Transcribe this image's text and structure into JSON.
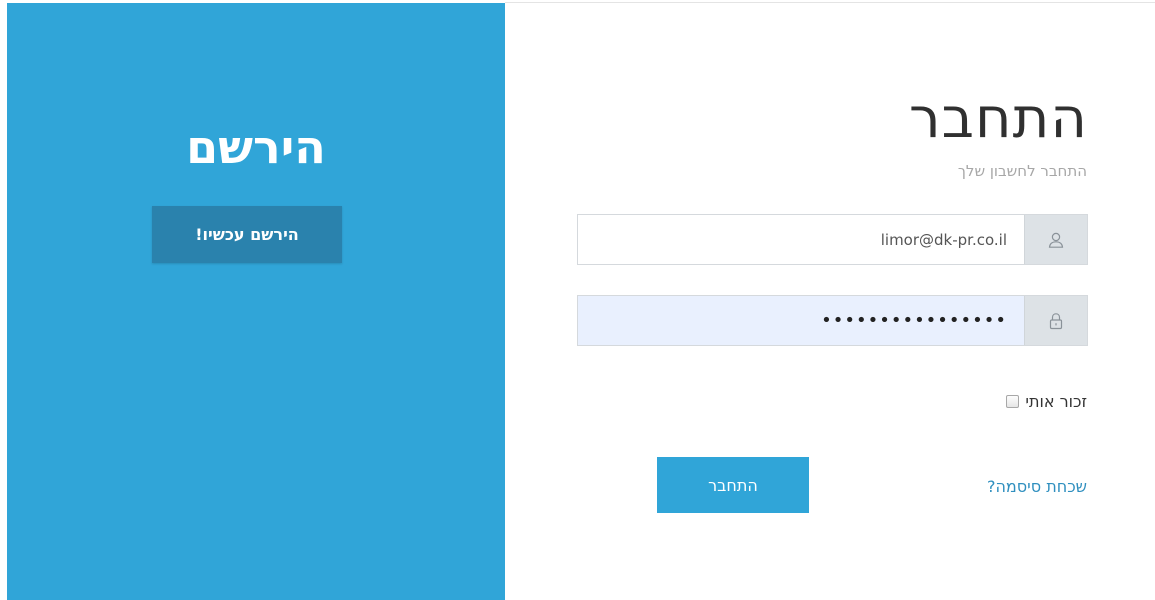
{
  "register": {
    "title": "הירשם",
    "button_label": "הירשם עכשיו!"
  },
  "login": {
    "title": "התחבר",
    "subtitle": "התחבר לחשבון שלך",
    "email": {
      "value": "limor@dk-pr.co.il",
      "icon": "user-icon"
    },
    "password": {
      "value": "••••••••••••••••",
      "icon": "lock-icon"
    },
    "remember_label": "זכור אותי",
    "remember_checked": false,
    "submit_label": "התחבר",
    "forgot_label": "שכחת סיסמה?"
  },
  "colors": {
    "panel_blue": "#30a5d8",
    "register_button": "#2a82ad",
    "link": "#2f8fbf",
    "autofill_bg": "#e9f0fe"
  }
}
